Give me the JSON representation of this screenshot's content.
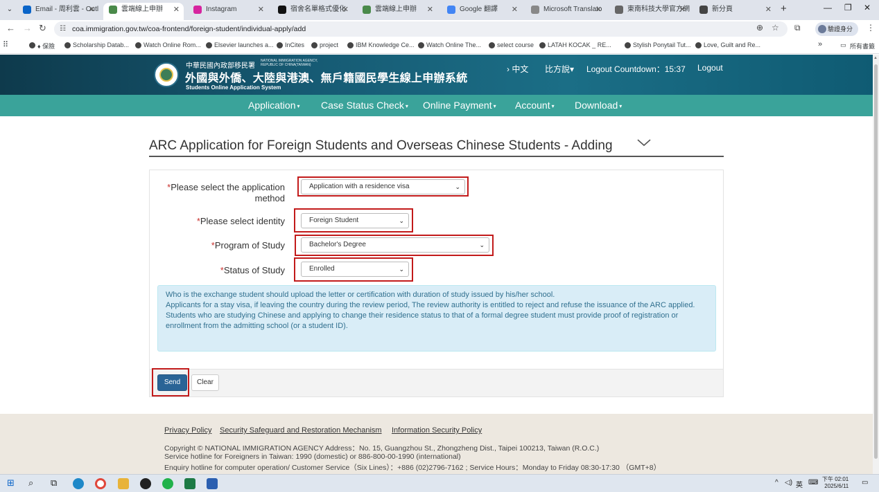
{
  "browser": {
    "tabs": [
      {
        "title": "Email - 周利雲 - Outl",
        "icon": "outlook-icon",
        "color": "#0a64c8"
      },
      {
        "title": "雲端線上申辦",
        "icon": "gov-seal-icon",
        "color": "#4a8a4a",
        "active": true
      },
      {
        "title": "Instagram",
        "icon": "instagram-icon",
        "color": "#d6249f"
      },
      {
        "title": "宿舍名單格式優化",
        "icon": "chatgpt-icon",
        "color": "#111111"
      },
      {
        "title": "雲端線上申辦",
        "icon": "gov-seal-icon",
        "color": "#4a8a4a"
      },
      {
        "title": "Google 翻譯",
        "icon": "google-translate-icon",
        "color": "#4285f4"
      },
      {
        "title": "Microsoft Translato",
        "icon": "ms-translator-icon",
        "color": "#888888"
      },
      {
        "title": "東南科技大學官方網",
        "icon": "school-icon",
        "color": "#666666"
      },
      {
        "title": "新分頁",
        "icon": "chrome-icon",
        "color": "#444444"
      }
    ],
    "url": "coa.immigration.gov.tw/coa-frontend/foreign-student/individual-apply/add",
    "profile_label": "驗證身分",
    "bookmarks": [
      "♦ 保險",
      "Scholarship Datab...",
      "Watch Online Rom...",
      "Elsevier launches a...",
      "InCites",
      "project",
      "IBM Knowledge Ce...",
      "Watch Online The...",
      "select course",
      "LATAH KOCAK _ RE...",
      "Stylish Ponytail Tut...",
      "Love, Guilt and Re..."
    ],
    "bookmarks_more": "»",
    "all_bookmarks": "所有書籤"
  },
  "header": {
    "agency_zh": "中華民國內政部移民署",
    "agency_en_1": "NATIONAL IMMIGRATION AGENCY,",
    "agency_en_2": "REPUBLIC OF CHINA(TAIWAN)",
    "title_zh": "外國與外僑、大陸與港澳、無戶籍國民學生線上申辦系統",
    "subtitle_en": "Students Online Application System",
    "lang_link": "› 中文",
    "font_size_link": "比方說▾",
    "logout_countdown": "Logout Countdown：15:37",
    "logout": "Logout"
  },
  "nav": {
    "items": [
      "Application",
      "Case Status Check",
      "Online Payment",
      "Account",
      "Download"
    ]
  },
  "page": {
    "title": "ARC Application for Foreign Students and Overseas Chinese Students - Adding"
  },
  "form": {
    "required_mark": "*",
    "method_label": "Please select the application method",
    "method_value": "Application with a residence visa",
    "identity_label": "Please select identity",
    "identity_value": "Foreign Student",
    "program_label": "Program of Study",
    "program_value": "Bachelor's Degree",
    "status_label": "Status of Study",
    "status_value": "Enrolled",
    "notice": [
      "Who is the exchange student should upload the letter or certification with duration of study issued by his/her school.",
      "Applicants for a stay visa, if leaving the country during the review period, The review authority is entitled to reject and refuse the issuance of the ARC applied.",
      "Students who are studying Chinese and applying to change their residence status to that of a formal degree student must provide proof of registration or enrollment from the admitting school (or a student ID)."
    ],
    "send": "Send",
    "clear": "Clear",
    "highlight_color": "#c21a1a"
  },
  "footer": {
    "links": [
      "Privacy Policy",
      "Security Safeguard and Restoration Mechanism",
      "Information Security Policy"
    ],
    "copyright": "Copyright © NATIONAL IMMIGRATION AGENCY Address：No. 15, Guangzhou St., Zhongzheng Dist., Taipei 100213, Taiwan (R.O.C.)",
    "hotline": "Service hotline for Foreigners in Taiwan: 1990 (domestic) or 886-800-00-1990 (international)",
    "enquiry": "Enquiry hotline for computer operation/ Customer Service（Six Lines）：+886 (02)2796-7162 ; Service Hours：Monday to Friday 08:30-17:30 （GMT+8）"
  },
  "taskbar": {
    "ime": "英",
    "time": "下午 02:01",
    "date": "2025/6/11"
  }
}
